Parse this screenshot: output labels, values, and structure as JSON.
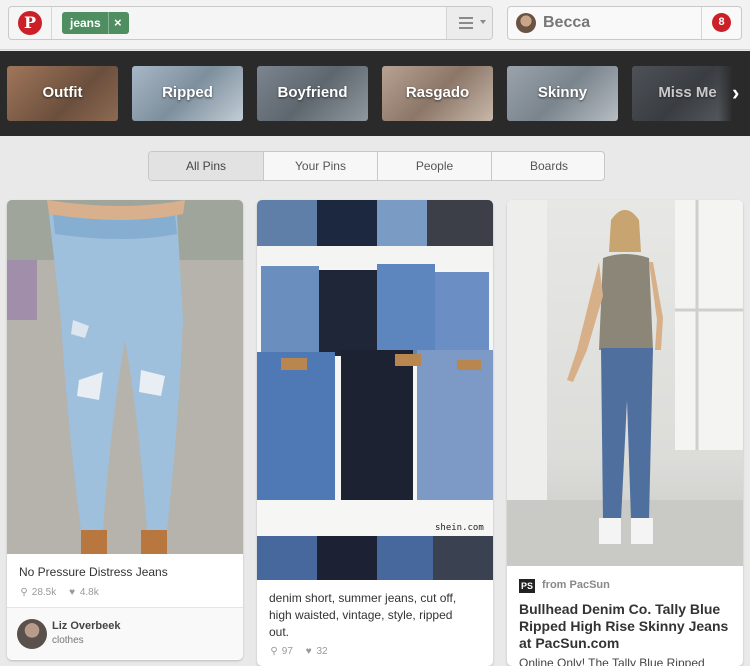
{
  "header": {
    "logo": "P",
    "search_chip": "jeans",
    "chip_remove": "×",
    "user_name": "Becca",
    "notifications": "8"
  },
  "guides": [
    {
      "label": "Outfit"
    },
    {
      "label": "Ripped"
    },
    {
      "label": "Boyfriend"
    },
    {
      "label": "Rasgado"
    },
    {
      "label": "Skinny"
    },
    {
      "label": "Miss Me"
    }
  ],
  "guide_next": "›",
  "tabs": [
    {
      "label": "All Pins",
      "selected": true
    },
    {
      "label": "Your Pins",
      "selected": false
    },
    {
      "label": "People",
      "selected": false
    },
    {
      "label": "Boards",
      "selected": false
    }
  ],
  "pins": [
    {
      "description": "No Pressure Distress Jeans",
      "repins": "28.5k",
      "likes": "4.8k",
      "pinner_name": "Liz Overbeek",
      "board": "clothes"
    },
    {
      "watermark": "shein.com",
      "description_lines": [
        "denim short, summer jeans, cut off,",
        "high waisted, vintage, style, ripped",
        "out."
      ],
      "repins": "97",
      "likes": "32"
    },
    {
      "source_badge": "PS",
      "source": "from PacSun",
      "title": "Bullhead Denim Co. Tally Blue Ripped High Rise Skinny Jeans at PacSun.com",
      "description_start": "Online Only! The Tally Blue Ripped"
    }
  ],
  "icons": {
    "repin": "pushpin-icon",
    "like": "heart-icon"
  }
}
